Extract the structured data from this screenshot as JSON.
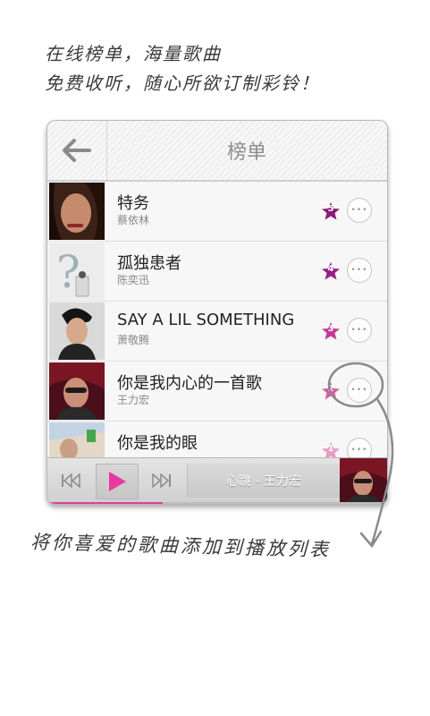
{
  "headline": {
    "line1": "在线榜单，海量歌曲",
    "line2": "免费收听，随心所欲订制彩铃！"
  },
  "header": {
    "title": "榜单"
  },
  "songs": [
    {
      "title": "特务",
      "artist": "蔡依林",
      "rank": "5",
      "more": "•••",
      "rank_color": "#8a1a7a"
    },
    {
      "title": "孤独患者",
      "artist": "陈奕迅",
      "rank": "4",
      "more": "•••",
      "rank_color": "#9a1f86"
    },
    {
      "title": "SAY A LIL SOMETHING",
      "artist": "萧敬腾",
      "rank": "3",
      "more": "•••",
      "rank_color": "#c43a93"
    },
    {
      "title": "你是我内心的一首歌",
      "artist": "王力宏",
      "rank": "2",
      "more": "•••",
      "rank_color": "#d85aa6"
    },
    {
      "title": "你是我的眼",
      "artist": "",
      "rank": "1",
      "more": "•••",
      "rank_color": "#e89ac4"
    }
  ],
  "player": {
    "now_playing": "心跳 - 王力宏",
    "progress": 0.34,
    "accent": "#e73aa0"
  },
  "footer": {
    "caption": "将你喜爱的歌曲添加到播放列表"
  },
  "icons": {
    "back": "arrow-left-icon",
    "prev": "skip-previous-icon",
    "play": "play-icon",
    "next": "skip-next-icon",
    "more": "more-dots-icon",
    "rank": "star-badge-icon"
  }
}
